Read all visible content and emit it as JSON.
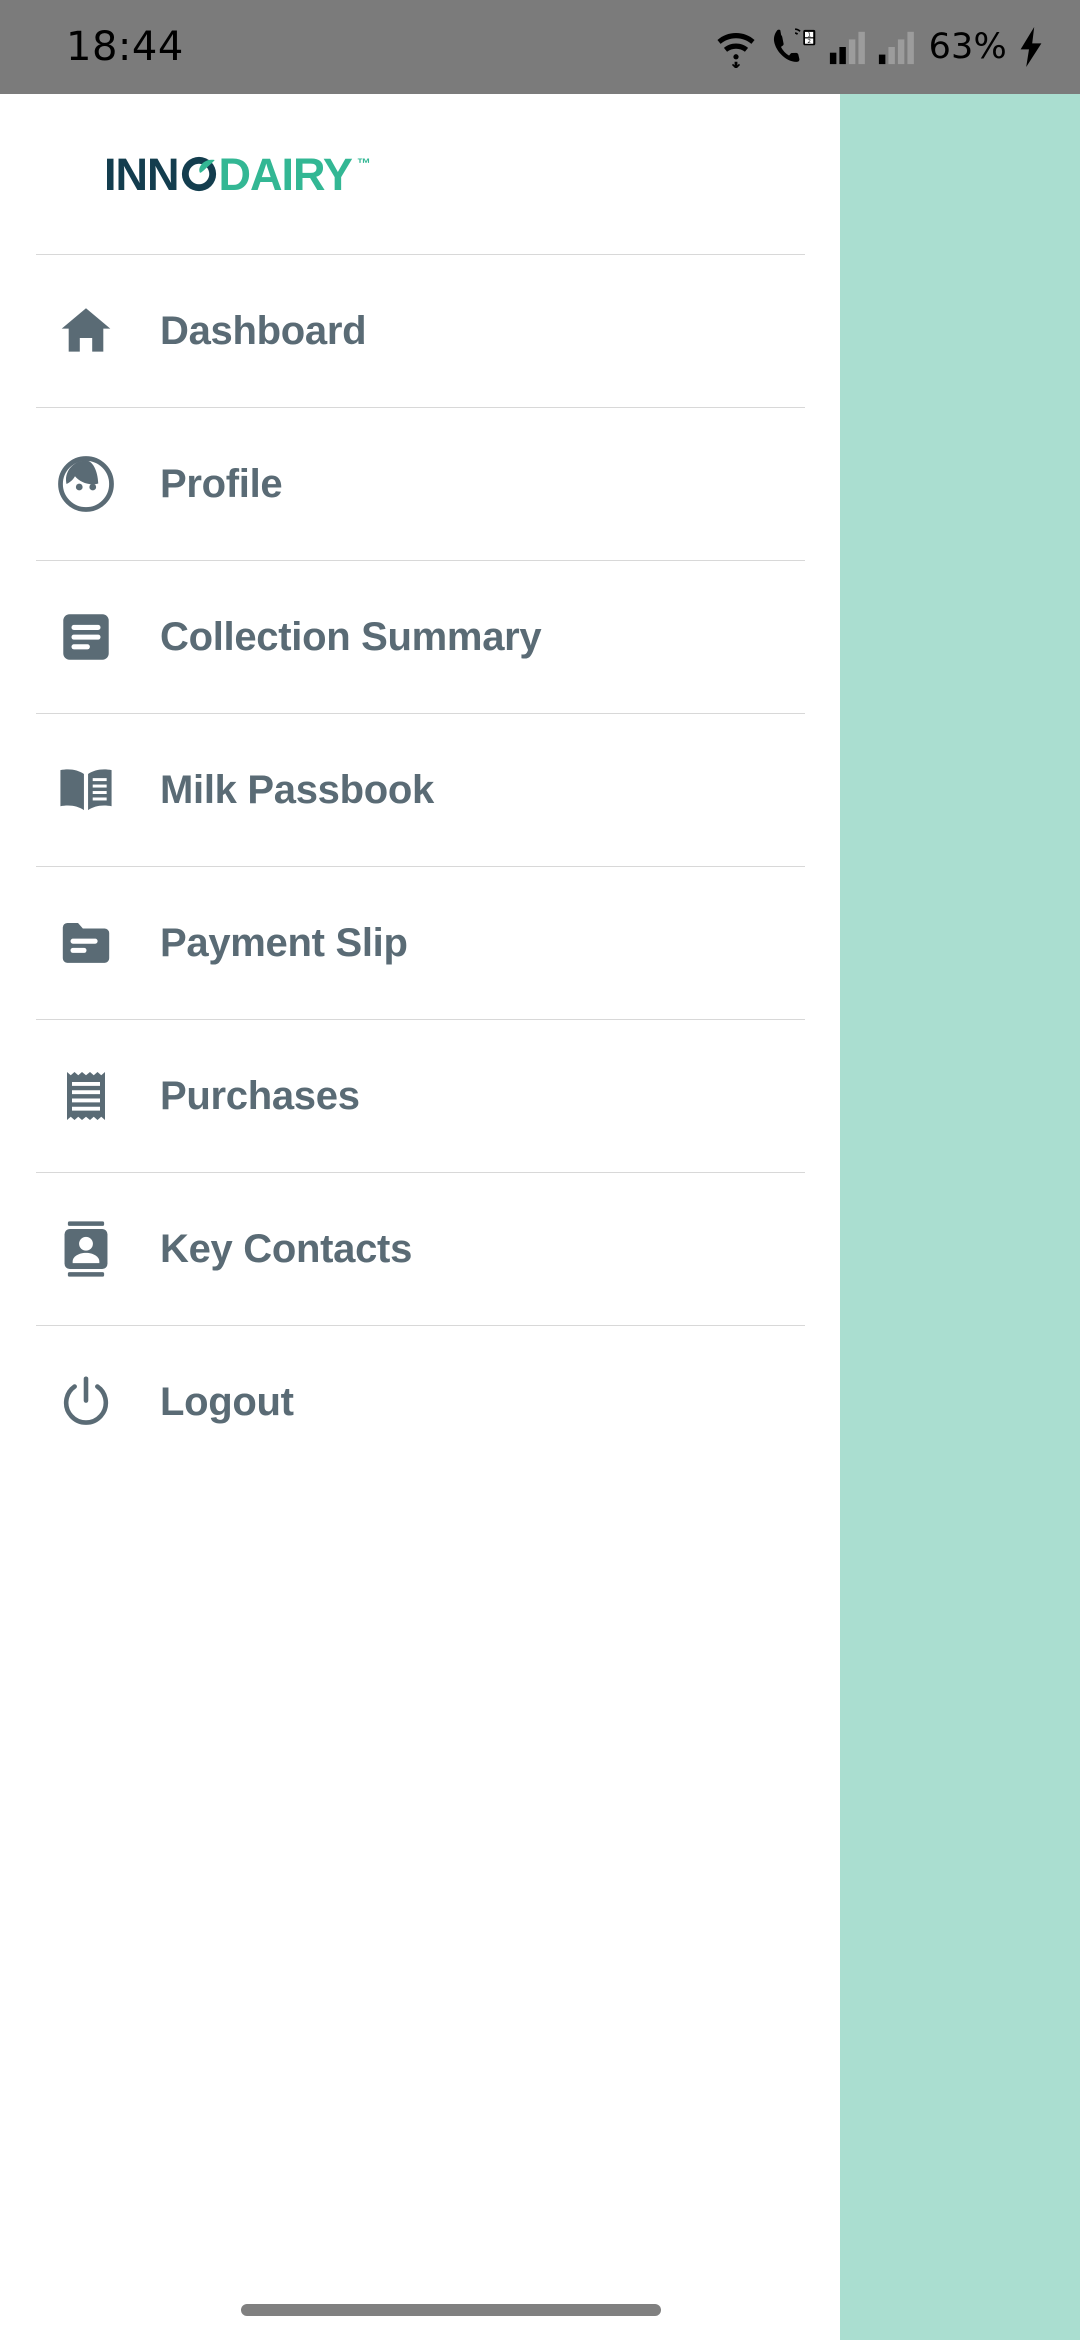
{
  "status_bar": {
    "time": "18:44",
    "battery_text": "63%",
    "icons": [
      "wifi-icon",
      "call-sim-icon",
      "signal-sim1-icon",
      "signal-sim2-icon",
      "charging-bolt-icon"
    ],
    "background_color": "#7b7b7b"
  },
  "brand": {
    "name_part1": "INN",
    "name_part2": "DAIRY",
    "trademark": "™",
    "color_dark": "#133d4e",
    "color_accent": "#33b794"
  },
  "scrim": {
    "color": "#aaded0"
  },
  "drawer": {
    "background_color": "#ffffff",
    "label_color": "#5a6b75",
    "divider_color": "#d8d8d8",
    "items": [
      {
        "label": "Dashboard",
        "icon": "home-icon"
      },
      {
        "label": "Profile",
        "icon": "user-face-icon"
      },
      {
        "label": "Collection Summary",
        "icon": "article-lines-icon"
      },
      {
        "label": "Milk Passbook",
        "icon": "open-book-icon"
      },
      {
        "label": "Payment Slip",
        "icon": "folder-icon"
      },
      {
        "label": "Purchases",
        "icon": "receipt-icon"
      },
      {
        "label": "Key Contacts",
        "icon": "contact-card-icon"
      },
      {
        "label": "Logout",
        "icon": "power-icon"
      }
    ]
  },
  "navigation": {
    "gesture_bar_color": "#808080"
  }
}
